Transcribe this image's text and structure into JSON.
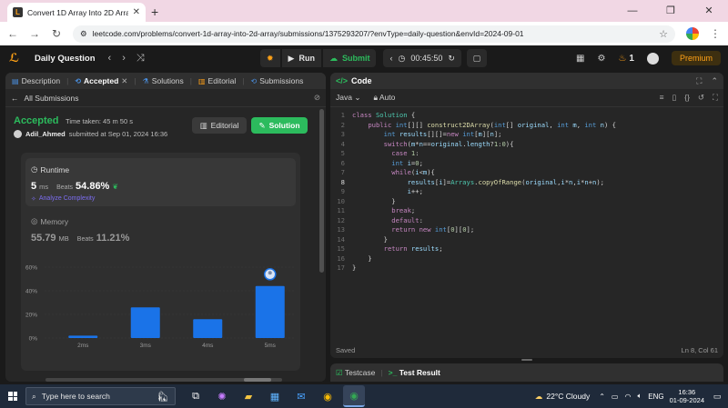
{
  "browser": {
    "tab_title": "Convert 1D Array Into 2D Array",
    "url": "leetcode.com/problems/convert-1d-array-into-2d-array/submissions/1375293207/?envType=daily-question&envId=2024-09-01"
  },
  "nav": {
    "daily_question": "Daily Question",
    "run": "Run",
    "submit": "Submit",
    "timer": "00:45:50",
    "streak": "1",
    "premium": "Premium"
  },
  "left_tabs": [
    "Description",
    "Accepted",
    "Solutions",
    "Editorial",
    "Submissions"
  ],
  "submission": {
    "all_submissions": "All Submissions",
    "status": "Accepted",
    "time_taken": "Time taken: 45 m 50 s",
    "user": "Adil_Ahmed",
    "submitted_at": "submitted at Sep 01, 2024 16:36",
    "editorial_btn": "Editorial",
    "solution_btn": "Solution",
    "runtime_label": "Runtime",
    "runtime_value": "5",
    "runtime_unit": "ms",
    "beats_label": "Beats",
    "runtime_beats": "54.86%",
    "analyze": "Analyze Complexity",
    "memory_label": "Memory",
    "memory_value": "55.79",
    "memory_unit": "MB",
    "memory_beats": "11.21%"
  },
  "chart_data": {
    "type": "bar",
    "categories": [
      "2ms",
      "3ms",
      "4ms",
      "5ms"
    ],
    "values": [
      2,
      26,
      16,
      44
    ],
    "ylim": [
      0,
      60
    ],
    "yticks": [
      "0%",
      "20%",
      "40%",
      "60%"
    ],
    "highlight": "5ms",
    "bar_color": "#1a73e8"
  },
  "editor": {
    "title": "Code",
    "language": "Java",
    "auto": "Auto",
    "lines": [
      "class Solution {",
      "    public int[][] construct2DArray(int[] original, int m, int n) {",
      "        int results[][]=new int[m][n];",
      "        switch(m*n==original.length?1:0){",
      "          case 1:",
      "          int i=0;",
      "          while(i<m){",
      "              results[i]=Arrays.copyOfRange(original,i*n,i*n+n);",
      "              i++;",
      "          }",
      "          break;",
      "          default:",
      "          return new int[0][0];",
      "        }",
      "        return results;",
      "    }",
      "}"
    ],
    "saved": "Saved",
    "cursor": "Ln 8, Col 61"
  },
  "bottom": {
    "testcase": "Testcase",
    "test_result": "Test Result"
  },
  "taskbar": {
    "search_placeholder": "Type here to search",
    "weather": "22°C  Cloudy",
    "lang": "ENG",
    "time": "16:36",
    "date": "01-09-2024"
  }
}
